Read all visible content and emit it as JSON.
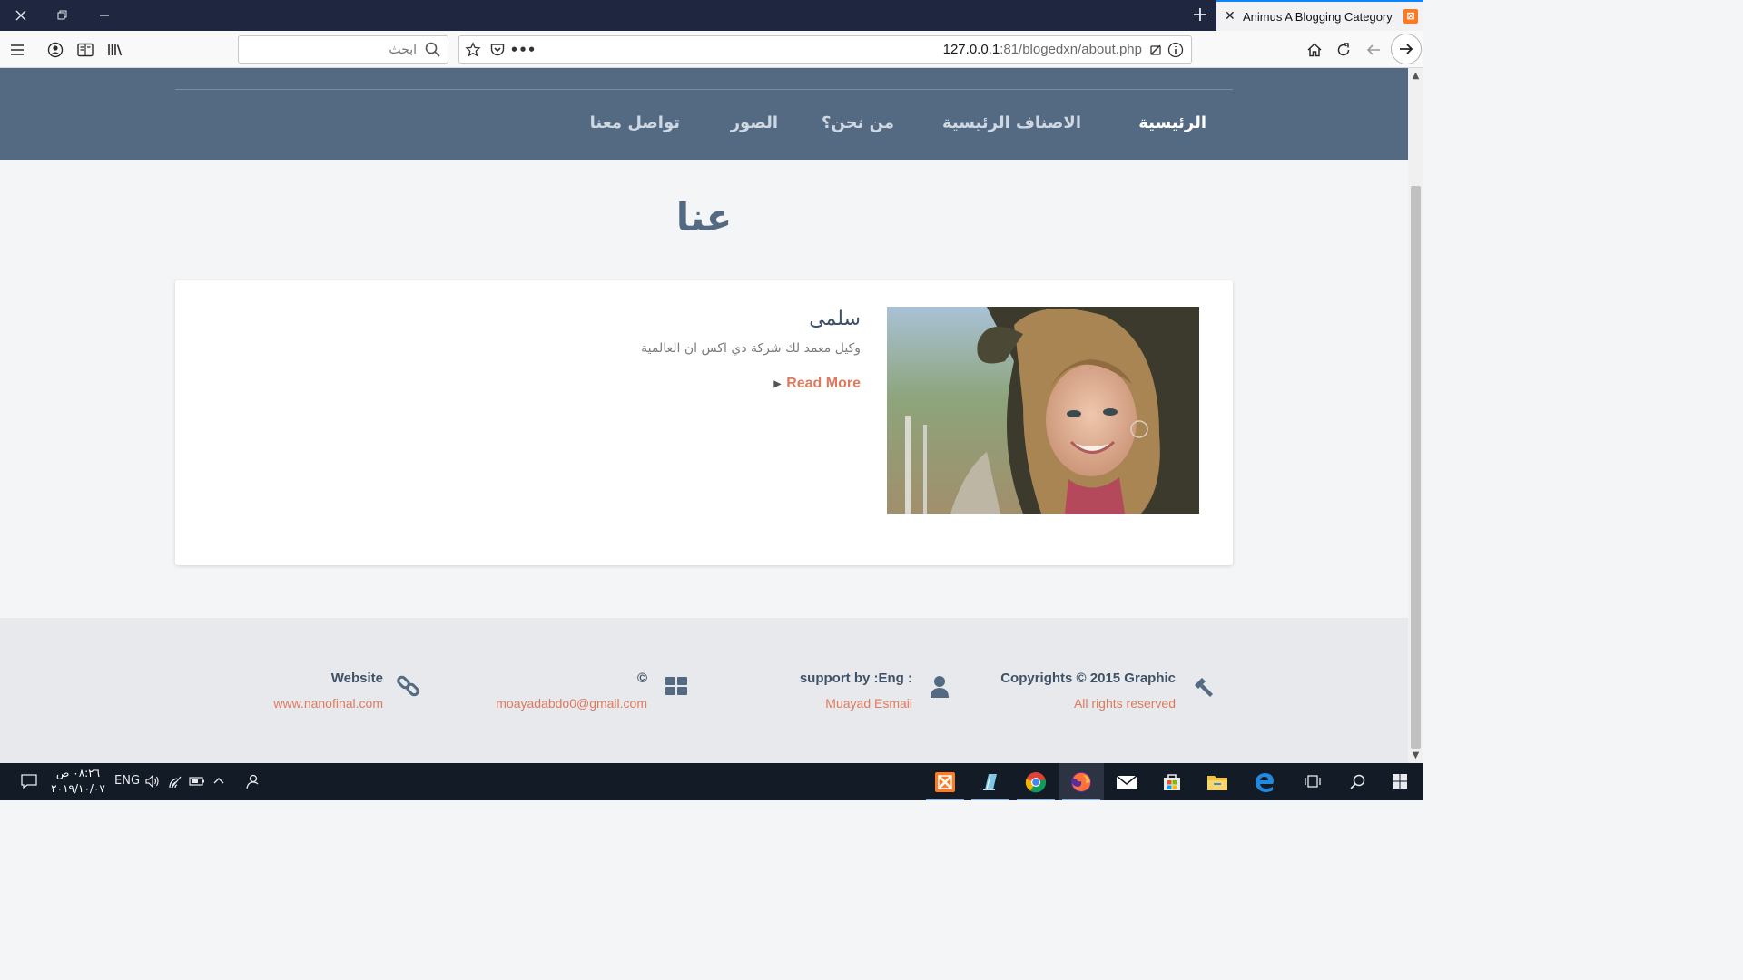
{
  "browser": {
    "tab_title": "Animus A Blogging Category F",
    "url_main": "127.0.0.1",
    "url_rest": ":81/blogedxn/about.php",
    "search_placeholder": "ابحث",
    "new_tab_symbol": "+",
    "tab_close_symbol": "✕"
  },
  "nav": {
    "items": [
      {
        "label": "الرئيسية",
        "active": true
      },
      {
        "label": "الاصناف الرئيسية",
        "active": false
      },
      {
        "label": "من نحن؟",
        "active": false
      },
      {
        "label": "الصور",
        "active": false
      },
      {
        "label": "تواصل معنا",
        "active": false
      }
    ]
  },
  "page": {
    "title": "عنا"
  },
  "card": {
    "name": "سلمى",
    "description": "وكيل معمد لك شركة دي اكس ان العالمية",
    "read_more": "Read More"
  },
  "footer": {
    "columns": [
      {
        "icon": "hammer-icon",
        "heading": "Copyrights © 2015 Graphic",
        "sub": "All rights reserved"
      },
      {
        "icon": "user-icon",
        "heading": "support by :Eng :",
        "sub": "Muayad Esmail"
      },
      {
        "icon": "grid-icon",
        "heading": "©",
        "sub": "moayadabdo0@gmail.com"
      },
      {
        "icon": "link-icon",
        "heading": "Website",
        "sub": "www.nanofinal.com"
      }
    ]
  },
  "taskbar": {
    "language": "ENG",
    "time": "٠٨:٢٦ ص",
    "date": "٢٠١٩/١٠/٠٧"
  },
  "colors": {
    "nav_bg": "#546a82",
    "accent_link": "#e07a5f",
    "page_bg": "#f4f5f7",
    "footer_bg": "#e7e9ec",
    "taskbar_bg": "#131b26",
    "tabbar_bg": "#1f2640"
  }
}
